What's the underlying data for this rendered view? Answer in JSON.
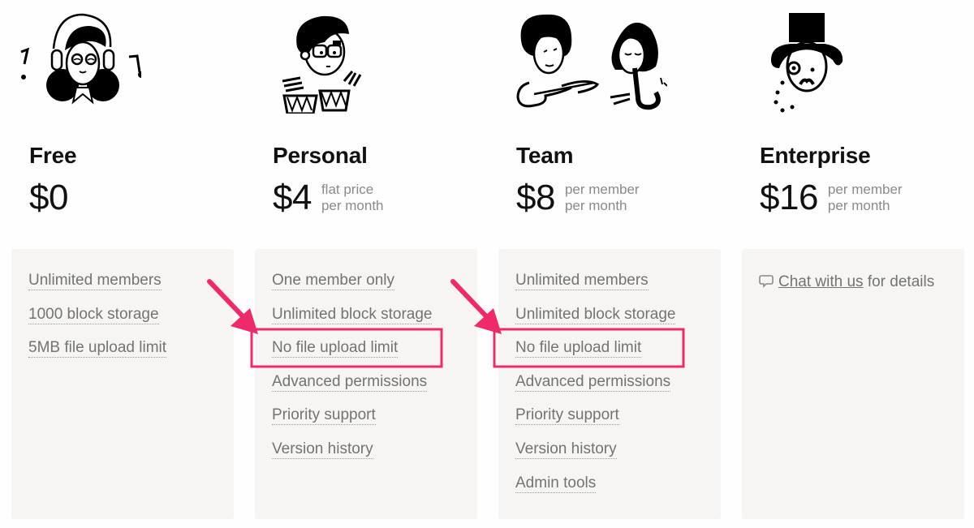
{
  "plans": [
    {
      "name": "Free",
      "price": "$0",
      "note_line1": "",
      "note_line2": "",
      "illustration": "person-with-headphones-music-notes",
      "features": [
        "Unlimited members",
        "1000 block storage",
        "5MB file upload limit"
      ]
    },
    {
      "name": "Personal",
      "price": "$4",
      "note_line1": "flat price",
      "note_line2": "per month",
      "illustration": "person-playing-bongo-drums",
      "features": [
        "One member only",
        "Unlimited block storage",
        "No file upload limit",
        "Advanced permissions",
        "Priority support",
        "Version history"
      ]
    },
    {
      "name": "Team",
      "price": "$8",
      "note_line1": "per member",
      "note_line2": "per month",
      "illustration": "two-musicians-guitar-saxophone",
      "features": [
        "Unlimited members",
        "Unlimited block storage",
        "No file upload limit",
        "Advanced permissions",
        "Priority support",
        "Version history",
        "Admin tools"
      ]
    },
    {
      "name": "Enterprise",
      "price": "$16",
      "note_line1": "per member",
      "note_line2": "per month",
      "illustration": "gentleman-top-hat-monocle",
      "chat_link": "Chat with us",
      "chat_suffix": " for details",
      "chat_icon": "speech-bubble-icon"
    }
  ],
  "annotations": {
    "color": "#ee2a6b",
    "highlighted_feature": "No file upload limit",
    "highlighted_plans": [
      "Personal",
      "Team"
    ]
  }
}
